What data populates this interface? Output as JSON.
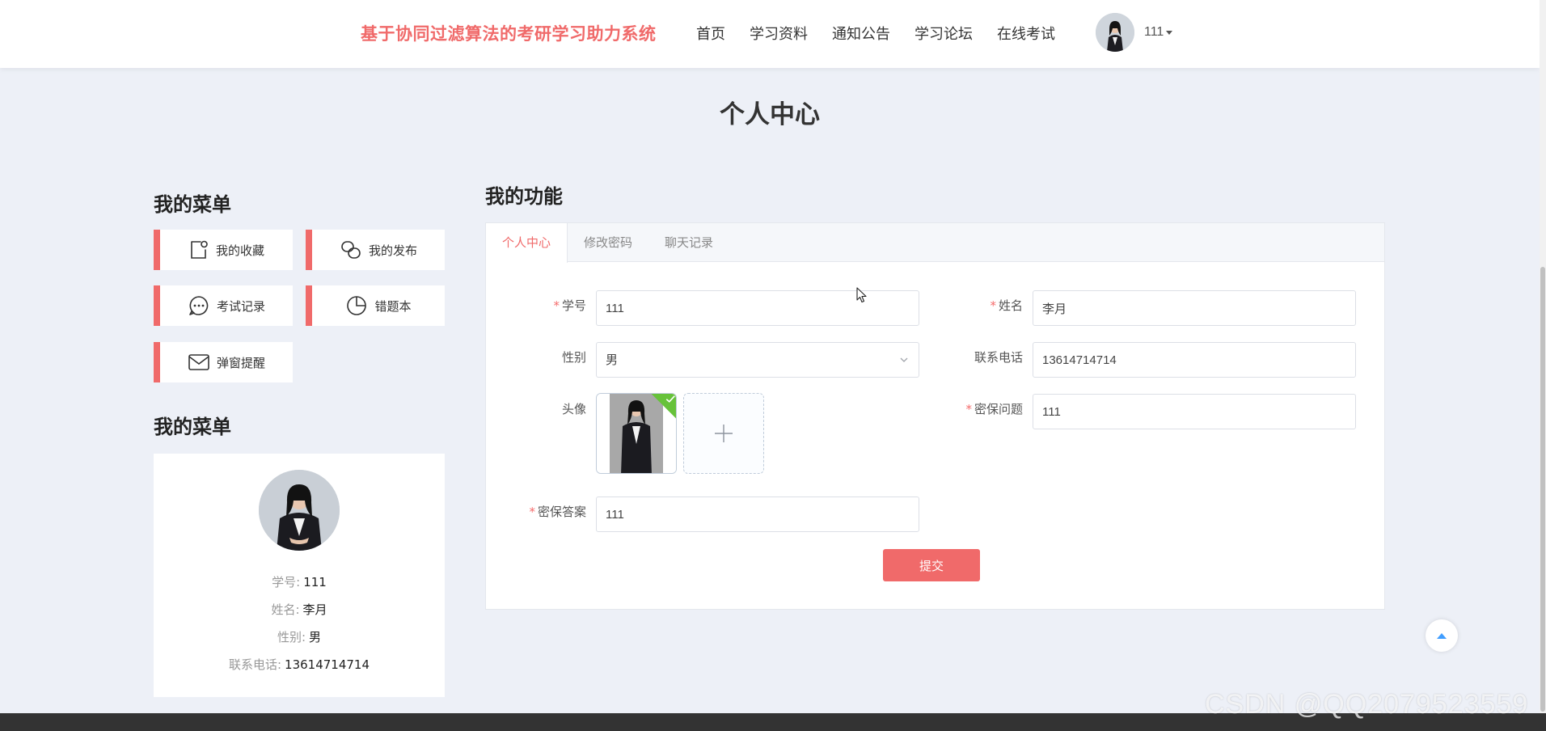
{
  "header": {
    "brand": "基于协同过滤算法的考研学习助力系统",
    "nav": [
      "首页",
      "学习资料",
      "通知公告",
      "学习论坛",
      "在线考试"
    ],
    "user_name": "111"
  },
  "page_title": "个人中心",
  "left": {
    "menu_heading": "我的菜单",
    "menu_items": [
      {
        "label": "我的收藏",
        "icon": "bookmark-icon"
      },
      {
        "label": "我的发布",
        "icon": "share-icon"
      },
      {
        "label": "考试记录",
        "icon": "chat-icon"
      },
      {
        "label": "错题本",
        "icon": "pie-chart-icon"
      },
      {
        "label": "弹窗提醒",
        "icon": "mail-icon"
      }
    ],
    "profile_heading": "我的菜单",
    "profile": [
      {
        "key": "学号:",
        "value": "111"
      },
      {
        "key": "姓名:",
        "value": "李月"
      },
      {
        "key": "性别:",
        "value": "男"
      },
      {
        "key": "联系电话:",
        "value": "13614714714"
      }
    ]
  },
  "right": {
    "heading": "我的功能",
    "tabs": [
      "个人中心",
      "修改密码",
      "聊天记录"
    ],
    "active_tab": "个人中心",
    "form": {
      "student_id": {
        "label": "学号",
        "value": "111",
        "required": true
      },
      "name": {
        "label": "姓名",
        "value": "李月",
        "required": true
      },
      "gender": {
        "label": "性别",
        "value": "男",
        "required": false
      },
      "phone": {
        "label": "联系电话",
        "value": "13614714714",
        "required": false
      },
      "avatar": {
        "label": "头像",
        "required": false
      },
      "security_question": {
        "label": "密保问题",
        "value": "111",
        "required": true
      },
      "security_answer": {
        "label": "密保答案",
        "value": "111",
        "required": true
      },
      "submit_label": "提交"
    }
  },
  "watermark": "CSDN @QQ2079523559",
  "colors": {
    "accent": "#f06a6a",
    "background": "#edf0f7",
    "success": "#67c23a"
  }
}
